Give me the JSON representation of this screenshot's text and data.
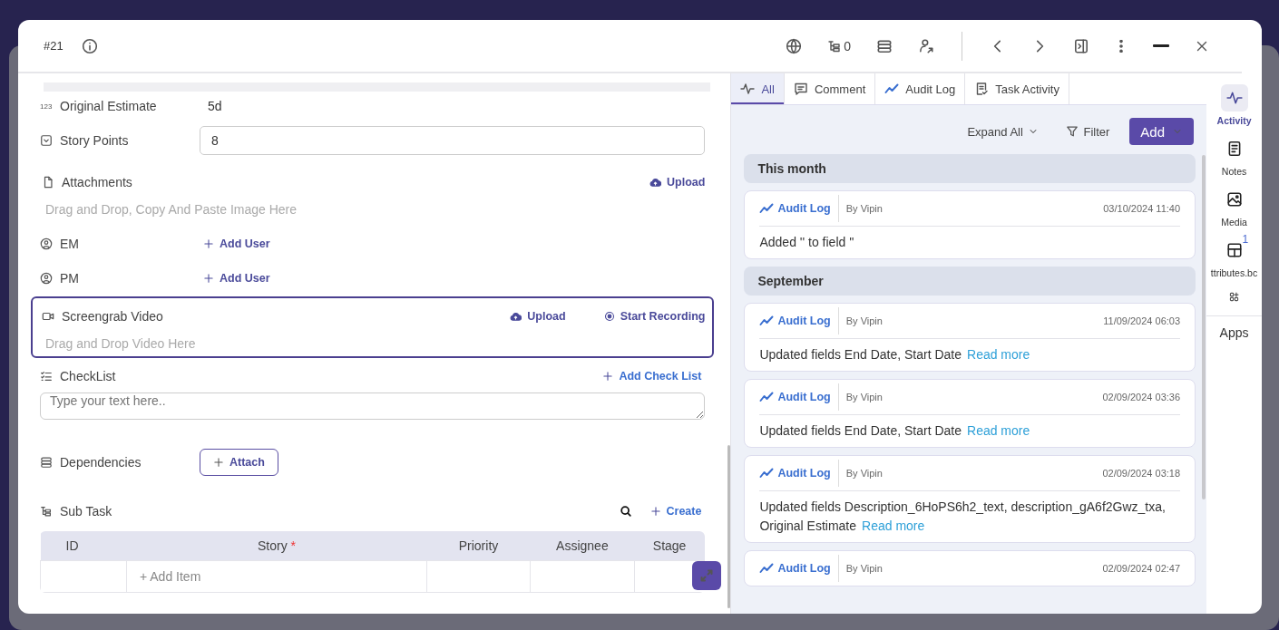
{
  "header": {
    "id": "#21",
    "hierarchy_count": "0"
  },
  "fields": [
    {
      "kind": "text",
      "label": "Original Estimate",
      "value": "5d",
      "icon_text": "123"
    },
    {
      "kind": "input",
      "label": "Story Points",
      "value": "8"
    },
    {
      "kind": "upload",
      "label": "Attachments",
      "actions": [
        "Upload"
      ],
      "placeholder": "Drag and Drop, Copy And Paste Image Here",
      "focused": false
    },
    {
      "kind": "user",
      "label": "EM",
      "action": "Add User"
    },
    {
      "kind": "user",
      "label": "PM",
      "action": "Add User"
    },
    {
      "kind": "upload",
      "label": "Screengrab Video",
      "actions": [
        "Upload",
        "Start Recording"
      ],
      "placeholder": "Drag and Drop Video Here",
      "focused": true
    },
    {
      "kind": "checklist",
      "label": "CheckList",
      "action": "Add Check List",
      "placeholder": "Type your text here.."
    },
    {
      "kind": "attach",
      "label": "Dependencies",
      "action": "Attach"
    }
  ],
  "subtask": {
    "title": "Sub Task",
    "action": "Create",
    "columns": [
      {
        "label": "ID",
        "required": false
      },
      {
        "label": "Story",
        "required": true
      },
      {
        "label": "Priority",
        "required": false
      },
      {
        "label": "Assignee",
        "required": false
      },
      {
        "label": "Stage",
        "required": false
      }
    ],
    "add_item": "+ Add Item",
    "required_mark": "*"
  },
  "activity": {
    "tabs": [
      {
        "label": "All",
        "selected": true
      },
      {
        "label": "Comment",
        "selected": false
      },
      {
        "label": "Audit Log",
        "selected": false
      },
      {
        "label": "Task Activity",
        "selected": false
      }
    ],
    "expand": "Expand All",
    "filter": "Filter",
    "add": "Add",
    "groups": [
      {
        "title": "This month",
        "entries": [
          {
            "type": "Audit Log",
            "author": "By Vipin",
            "time": "03/10/2024 11:40",
            "text": "Added '' to field ''"
          }
        ]
      },
      {
        "title": "September",
        "entries": [
          {
            "type": "Audit Log",
            "author": "By Vipin",
            "time": "11/09/2024 06:03",
            "text": "Updated fields End Date, Start Date",
            "link": "Read more"
          },
          {
            "type": "Audit Log",
            "author": "By Vipin",
            "time": "02/09/2024 03:36",
            "text": "Updated fields End Date, Start Date",
            "link": "Read more"
          },
          {
            "type": "Audit Log",
            "author": "By Vipin",
            "time": "02/09/2024 03:18",
            "text": "Updated fields Description_6HoPS6h2_text, description_gA6f2Gwz_txa, Original Estimate",
            "link": "Read more"
          },
          {
            "type": "Audit Log",
            "author": "By Vipin",
            "time": "02/09/2024 02:47"
          }
        ]
      }
    ]
  },
  "rail": {
    "items": [
      {
        "label": "Activity",
        "selected": true
      },
      {
        "label": "Notes",
        "selected": false
      },
      {
        "label": "Media",
        "selected": false
      },
      {
        "label": "ttributes.bc",
        "selected": false,
        "badge": "1"
      }
    ],
    "apps": "Apps"
  }
}
